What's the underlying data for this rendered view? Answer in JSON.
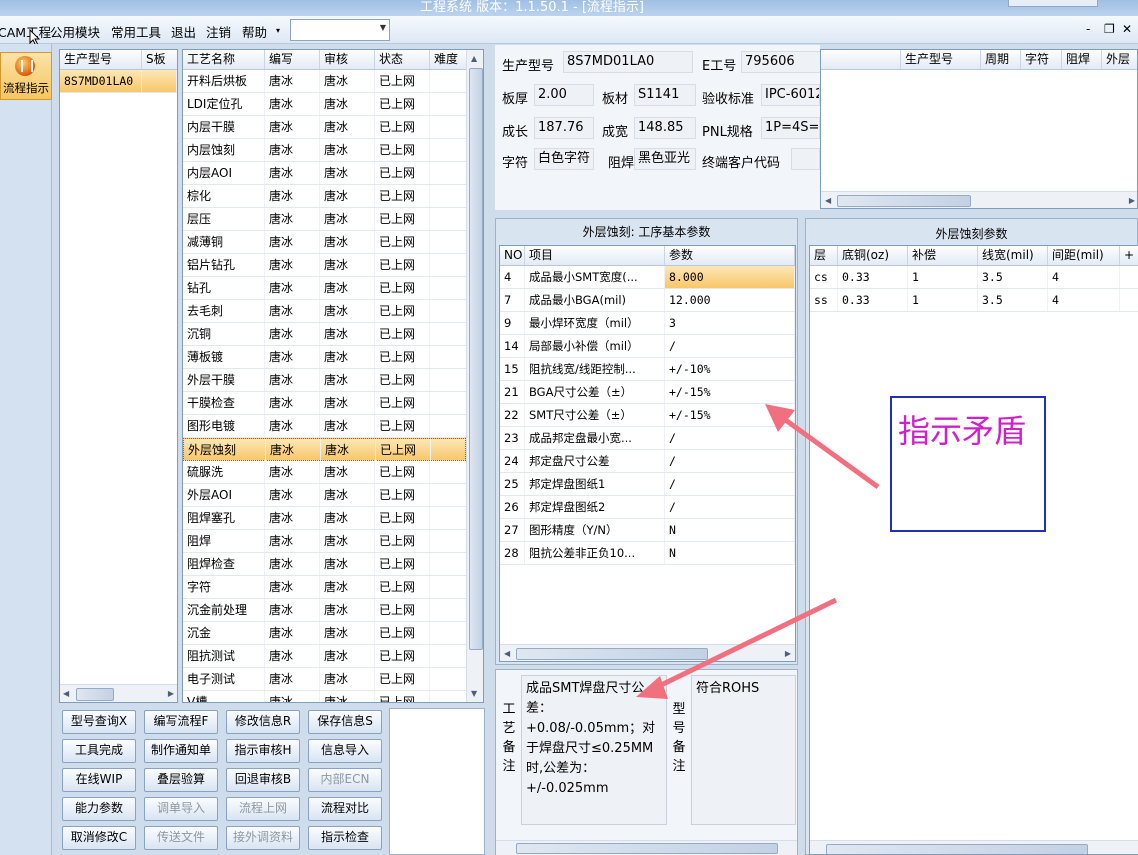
{
  "window": {
    "title": "工程系统  版本：1.1.50.1 - [流程指示]"
  },
  "menubar": {
    "items": [
      "CAM工程",
      "公用模块",
      "常用工具",
      "退出",
      "注销",
      "帮助"
    ],
    "combo_value": "",
    "mdi": [
      "-",
      "❐",
      "✕"
    ]
  },
  "leftbar": {
    "button_label": "流程指示"
  },
  "models": {
    "headers": [
      "生产型号",
      "S板"
    ],
    "rows": [
      [
        "8S7MD01LA0",
        ""
      ]
    ]
  },
  "processes": {
    "headers": [
      "工艺名称",
      "编写",
      "审核",
      "状态",
      "难度"
    ],
    "selected_index": 16,
    "rows": [
      [
        "开料后烘板",
        "唐冰",
        "唐冰",
        "已上网",
        ""
      ],
      [
        "LDI定位孔",
        "唐冰",
        "唐冰",
        "已上网",
        ""
      ],
      [
        "内层干膜",
        "唐冰",
        "唐冰",
        "已上网",
        ""
      ],
      [
        "内层蚀刻",
        "唐冰",
        "唐冰",
        "已上网",
        ""
      ],
      [
        "内层AOI",
        "唐冰",
        "唐冰",
        "已上网",
        ""
      ],
      [
        "棕化",
        "唐冰",
        "唐冰",
        "已上网",
        ""
      ],
      [
        "层压",
        "唐冰",
        "唐冰",
        "已上网",
        ""
      ],
      [
        "减薄铜",
        "唐冰",
        "唐冰",
        "已上网",
        ""
      ],
      [
        "铝片钻孔",
        "唐冰",
        "唐冰",
        "已上网",
        ""
      ],
      [
        "钻孔",
        "唐冰",
        "唐冰",
        "已上网",
        ""
      ],
      [
        "去毛刺",
        "唐冰",
        "唐冰",
        "已上网",
        ""
      ],
      [
        "沉铜",
        "唐冰",
        "唐冰",
        "已上网",
        ""
      ],
      [
        "薄板镀",
        "唐冰",
        "唐冰",
        "已上网",
        ""
      ],
      [
        "外层干膜",
        "唐冰",
        "唐冰",
        "已上网",
        ""
      ],
      [
        "干膜检查",
        "唐冰",
        "唐冰",
        "已上网",
        ""
      ],
      [
        "图形电镀",
        "唐冰",
        "唐冰",
        "已上网",
        ""
      ],
      [
        "外层蚀刻",
        "唐冰",
        "唐冰",
        "已上网",
        ""
      ],
      [
        "硫脲洗",
        "唐冰",
        "唐冰",
        "已上网",
        ""
      ],
      [
        "外层AOI",
        "唐冰",
        "唐冰",
        "已上网",
        ""
      ],
      [
        "阻焊塞孔",
        "唐冰",
        "唐冰",
        "已上网",
        ""
      ],
      [
        "阻焊",
        "唐冰",
        "唐冰",
        "已上网",
        ""
      ],
      [
        "阻焊检查",
        "唐冰",
        "唐冰",
        "已上网",
        ""
      ],
      [
        "字符",
        "唐冰",
        "唐冰",
        "已上网",
        ""
      ],
      [
        "沉金前处理",
        "唐冰",
        "唐冰",
        "已上网",
        ""
      ],
      [
        "沉金",
        "唐冰",
        "唐冰",
        "已上网",
        ""
      ],
      [
        "阻抗测试",
        "唐冰",
        "唐冰",
        "已上网",
        ""
      ],
      [
        "电子测试",
        "唐冰",
        "唐冰",
        "已上网",
        ""
      ],
      [
        "V槽",
        "唐冰",
        "唐冰",
        "已上网",
        ""
      ]
    ]
  },
  "buttons": [
    {
      "label": "型号查询X",
      "enabled": true
    },
    {
      "label": "编写流程F",
      "enabled": true
    },
    {
      "label": "修改信息R",
      "enabled": true
    },
    {
      "label": "保存信息S",
      "enabled": true
    },
    {
      "label": "工具完成",
      "enabled": true
    },
    {
      "label": "制作通知单",
      "enabled": true
    },
    {
      "label": "指示审核H",
      "enabled": true
    },
    {
      "label": "信息导入",
      "enabled": true
    },
    {
      "label": "在线WIP",
      "enabled": true
    },
    {
      "label": "叠层验算",
      "enabled": true
    },
    {
      "label": "回退审核B",
      "enabled": true
    },
    {
      "label": "内部ECN",
      "enabled": false
    },
    {
      "label": "能力参数",
      "enabled": true
    },
    {
      "label": "调单导入",
      "enabled": false
    },
    {
      "label": "流程上网",
      "enabled": false
    },
    {
      "label": "流程对比",
      "enabled": true
    },
    {
      "label": "取消修改C",
      "enabled": true
    },
    {
      "label": "传送文件",
      "enabled": false
    },
    {
      "label": "接外调资料",
      "enabled": false
    },
    {
      "label": "指示检查",
      "enabled": true
    }
  ],
  "info": {
    "model_label": "生产型号",
    "model_value": "8S7MD01LA0",
    "eno_label": "E工号",
    "eno_value": "795606",
    "thickness_label": "板厚",
    "thickness_value": "2.00",
    "material_label": "板材",
    "material_value": "S1141",
    "standard_label": "验收标准",
    "standard_value": "IPC-6012",
    "length_label": "成长",
    "length_value": "187.76",
    "width_label": "成宽",
    "width_value": "148.85",
    "pnl_label": "PNL规格",
    "pnl_value": "1P=4S=6",
    "char_label": "字符",
    "char_value": "白色字符",
    "mask_label": "阻焊",
    "mask_value": "黑色亚光",
    "customer_label": "终端客户代码",
    "customer_value": ""
  },
  "right_grid": {
    "headers": [
      "生产型号",
      "周期",
      "字符",
      "阻焊",
      "外层"
    ]
  },
  "params": {
    "title": "外层蚀刻: 工序基本参数",
    "headers": [
      "NO",
      "项目",
      "参数"
    ],
    "selected_index": 0,
    "rows": [
      [
        "4",
        "成品最小SMT宽度(...",
        "8.000"
      ],
      [
        "7",
        "成品最小BGA(mil)",
        "12.000"
      ],
      [
        "9",
        "最小焊环宽度（mil）",
        "3"
      ],
      [
        "14",
        "局部最小补偿（mil）",
        "/"
      ],
      [
        "15",
        "阻抗线宽/线距控制...",
        "+/-10%"
      ],
      [
        "21",
        "BGA尺寸公差（±）",
        "+/-15%"
      ],
      [
        "22",
        "SMT尺寸公差（±）",
        "+/-15%"
      ],
      [
        "23",
        "成品邦定盘最小宽...",
        "/"
      ],
      [
        "24",
        "邦定盘尺寸公差",
        "/"
      ],
      [
        "25",
        "邦定焊盘图纸1",
        "/"
      ],
      [
        "26",
        "邦定焊盘图纸2",
        "/"
      ],
      [
        "27",
        "图形精度（Y/N）",
        "N"
      ],
      [
        "28",
        "阻抗公差非正负10...",
        "N"
      ]
    ]
  },
  "etch": {
    "title": "外层蚀刻参数",
    "headers": [
      "层",
      "底铜(oz)",
      "补偿",
      "线宽(mil)",
      "间距(mil)",
      "+"
    ],
    "rows": [
      [
        "cs",
        "0.33",
        "1",
        "3.5",
        "4"
      ],
      [
        "ss",
        "0.33",
        "1",
        "3.5",
        "4"
      ]
    ]
  },
  "notes": {
    "process_label": [
      "工",
      "艺",
      "备",
      "注"
    ],
    "process_text": "成品SMT焊盘尺寸公差：+0.08/-0.05mm；对于焊盘尺寸≤0.25MM时,公差为：+/-0.025mm",
    "model_label": [
      "型",
      "号",
      "备",
      "注"
    ],
    "model_text": "符合ROHS"
  },
  "annotation": {
    "text": "指示矛盾",
    "text_color": "#d020c8",
    "border_color": "#1f2fb8",
    "arrow_color": "#f07080"
  }
}
